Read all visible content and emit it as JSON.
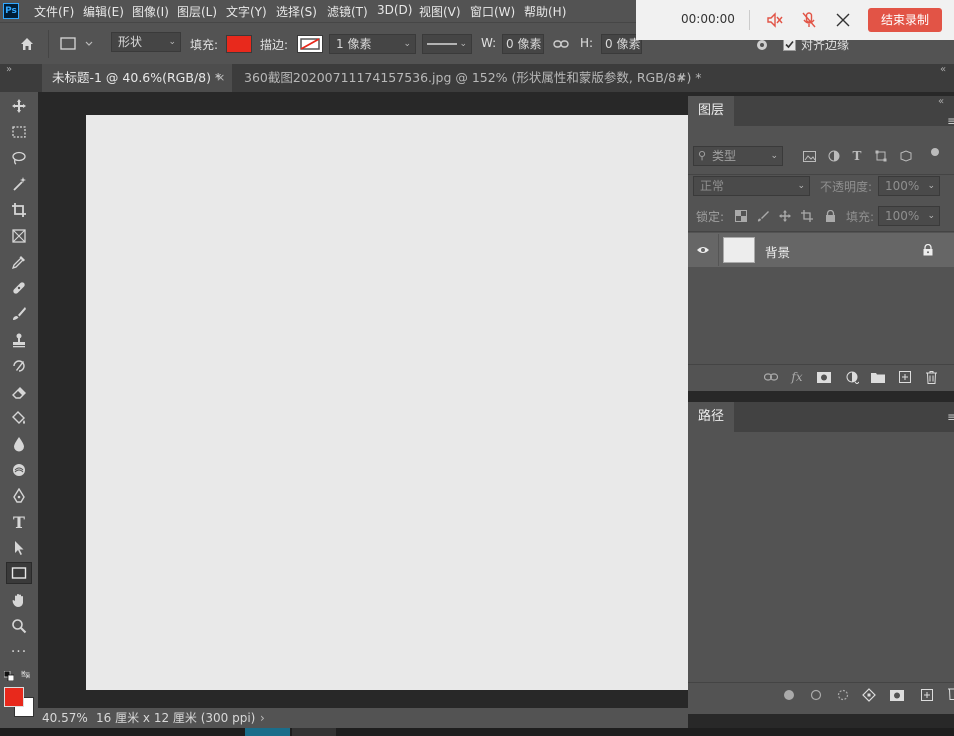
{
  "app": {
    "logo": "Ps"
  },
  "menu": [
    "文件(F)",
    "编辑(E)",
    "图像(I)",
    "图层(L)",
    "文字(Y)",
    "选择(S)",
    "滤镜(T)",
    "3D(D)",
    "视图(V)",
    "窗口(W)",
    "帮助(H)"
  ],
  "options": {
    "mode_value": "形状",
    "fill_label": "填充:",
    "fill_color": "#e8291c",
    "stroke_label": "描边:",
    "stroke_width": "1 像素",
    "w_label": "W:",
    "w_value": "0 像素",
    "h_label": "H:",
    "h_value": "0 像素",
    "align_edges_label": "对齐边缘"
  },
  "tabs": [
    {
      "label": "未标题-1 @ 40.6%(RGB/8) *"
    },
    {
      "label": "360截图20200711174157536.jpg @ 152% (形状属性和蒙版参数, RGB/8#) *"
    }
  ],
  "status": {
    "zoom": "40.57%",
    "doc_info": "16 厘米 x 12 厘米 (300 ppi)"
  },
  "colors": {
    "foreground": "#e8291c",
    "background": "#ffffff"
  },
  "layers_panel": {
    "title": "图层",
    "filter_placeholder": "类型",
    "blend_mode": "正常",
    "opacity_label": "不透明度:",
    "opacity_value": "100%",
    "lock_label": "锁定:",
    "fill_label": "填充:",
    "fill_value": "100%",
    "layers": [
      {
        "name": "背景"
      }
    ]
  },
  "paths_panel": {
    "title": "路径"
  },
  "recording": {
    "time": "00:00:00",
    "stop_label": "结束录制"
  }
}
